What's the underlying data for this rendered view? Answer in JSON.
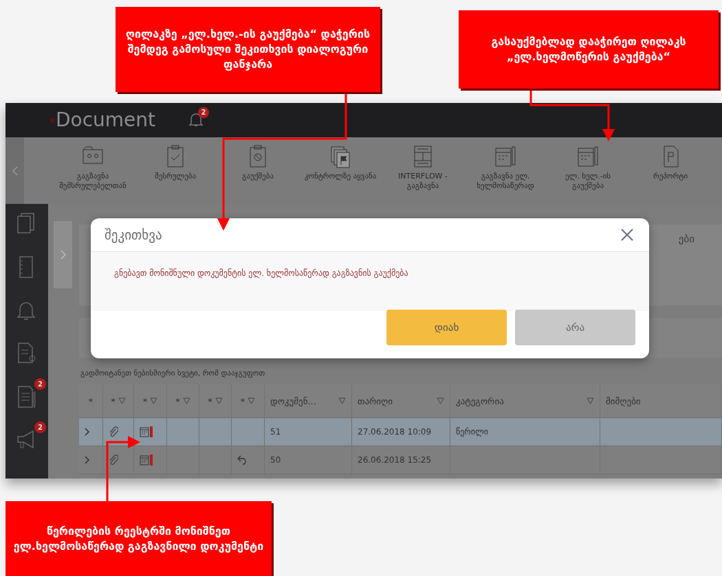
{
  "callouts": [
    {
      "text": "ღილაკზე „ელ.ხელ.-ის გაუქმება“  დაჭერის შემდეგ გამოსული შეკითხვის დიალოგური ფანჯარა"
    },
    {
      "text": "გასაუქმებლად დააჭირეთ ღილაკს „ელ.ხელმოწერის გაუქმება“"
    },
    {
      "text": "წერილების რეესტრში მონიშნეთ ელ.ხელმოსაწერად გაგზავნილი დოკუმენტი"
    }
  ],
  "header": {
    "logo": "Document",
    "notifications": "2"
  },
  "toolbar": {
    "items": [
      {
        "label": "გაგზავნა შემსრულებელთან"
      },
      {
        "label": "შესრულება"
      },
      {
        "label": "გაუქმება"
      },
      {
        "label": "კონტროლზე აყვანა"
      },
      {
        "label": "INTERFLOW - გაგზავნა"
      },
      {
        "label": "გაგზავნა ელ. ხელმოსაწერად"
      },
      {
        "label": "ელ. ხელ.-ის გაუქმება"
      },
      {
        "label": "რეპორტი"
      }
    ]
  },
  "sidebar": {
    "badges": [
      "2",
      "2"
    ]
  },
  "panel": {
    "heading_fragment": "ები"
  },
  "dialog": {
    "title": "შეკითხვა",
    "message": "გნებავთ მონიშნული დოკუმენტის ელ. ხელმოსაწერად გაგზავნის გაუქმება",
    "buttons": [
      {
        "label": "დიახ",
        "kind": "primary"
      },
      {
        "label": "არა",
        "kind": "secondary"
      }
    ]
  },
  "grid": {
    "group_hint": "გადმოიტანეთ ნებისმიერი სვეტი, რომ დააჯგუფოთ",
    "columns": [
      {
        "label": "*",
        "filter": false
      },
      {
        "label": "*",
        "filter": true
      },
      {
        "label": "*",
        "filter": true
      },
      {
        "label": "*",
        "filter": true
      },
      {
        "label": "*",
        "filter": true
      },
      {
        "label": "*",
        "filter": true
      },
      {
        "label": "დოკუმენ...",
        "filter": true
      },
      {
        "label": "თარიღი",
        "filter": true
      },
      {
        "label": "კატეგორია",
        "filter": true
      },
      {
        "label": "მიმღები",
        "filter": false
      }
    ],
    "rows": [
      {
        "selected": true,
        "attachment": true,
        "signature": true,
        "reply": false,
        "number": "51",
        "date": "27.06.2018 10:09",
        "category": "წერილი"
      },
      {
        "selected": false,
        "attachment": true,
        "signature": true,
        "reply": true,
        "number": "50",
        "date": "26.06.2018 15:25"
      }
    ]
  }
}
